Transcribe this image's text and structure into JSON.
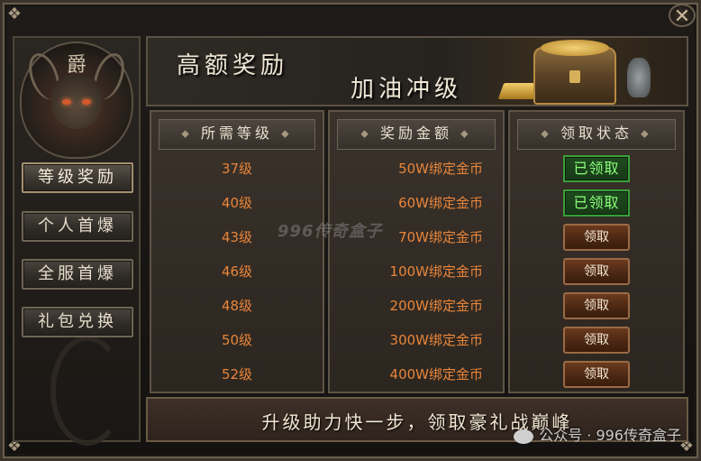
{
  "banner": {
    "title": "高额奖励",
    "subtitle": "加油冲级"
  },
  "sidebar": {
    "emblem_glyph": "爵",
    "items": [
      {
        "label": "等级奖励",
        "active": true
      },
      {
        "label": "个人首爆",
        "active": false
      },
      {
        "label": "全服首爆",
        "active": false
      },
      {
        "label": "礼包兑换",
        "active": false
      }
    ]
  },
  "columns": {
    "level": "所需等级",
    "reward": "奖励金额",
    "status": "领取状态"
  },
  "rows": [
    {
      "level": "37级",
      "reward": "50W绑定金币",
      "status": "已领取",
      "claimed": true
    },
    {
      "level": "40级",
      "reward": "60W绑定金币",
      "status": "已领取",
      "claimed": true
    },
    {
      "level": "43级",
      "reward": "70W绑定金币",
      "status": "领取",
      "claimed": false
    },
    {
      "level": "46级",
      "reward": "100W绑定金币",
      "status": "领取",
      "claimed": false
    },
    {
      "level": "48级",
      "reward": "200W绑定金币",
      "status": "领取",
      "claimed": false
    },
    {
      "level": "50级",
      "reward": "300W绑定金币",
      "status": "领取",
      "claimed": false
    },
    {
      "level": "52级",
      "reward": "400W绑定金币",
      "status": "领取",
      "claimed": false
    }
  ],
  "footer": "升级助力快一步，领取豪礼战巅峰",
  "watermark_center": "996传奇盒子",
  "watermark": "公众号 · 996传奇盒子",
  "close_symbol": "✕",
  "colors": {
    "reward_text": "#e8853a",
    "claimed_text": "#8cff7a",
    "claimed_border": "#38a038"
  }
}
